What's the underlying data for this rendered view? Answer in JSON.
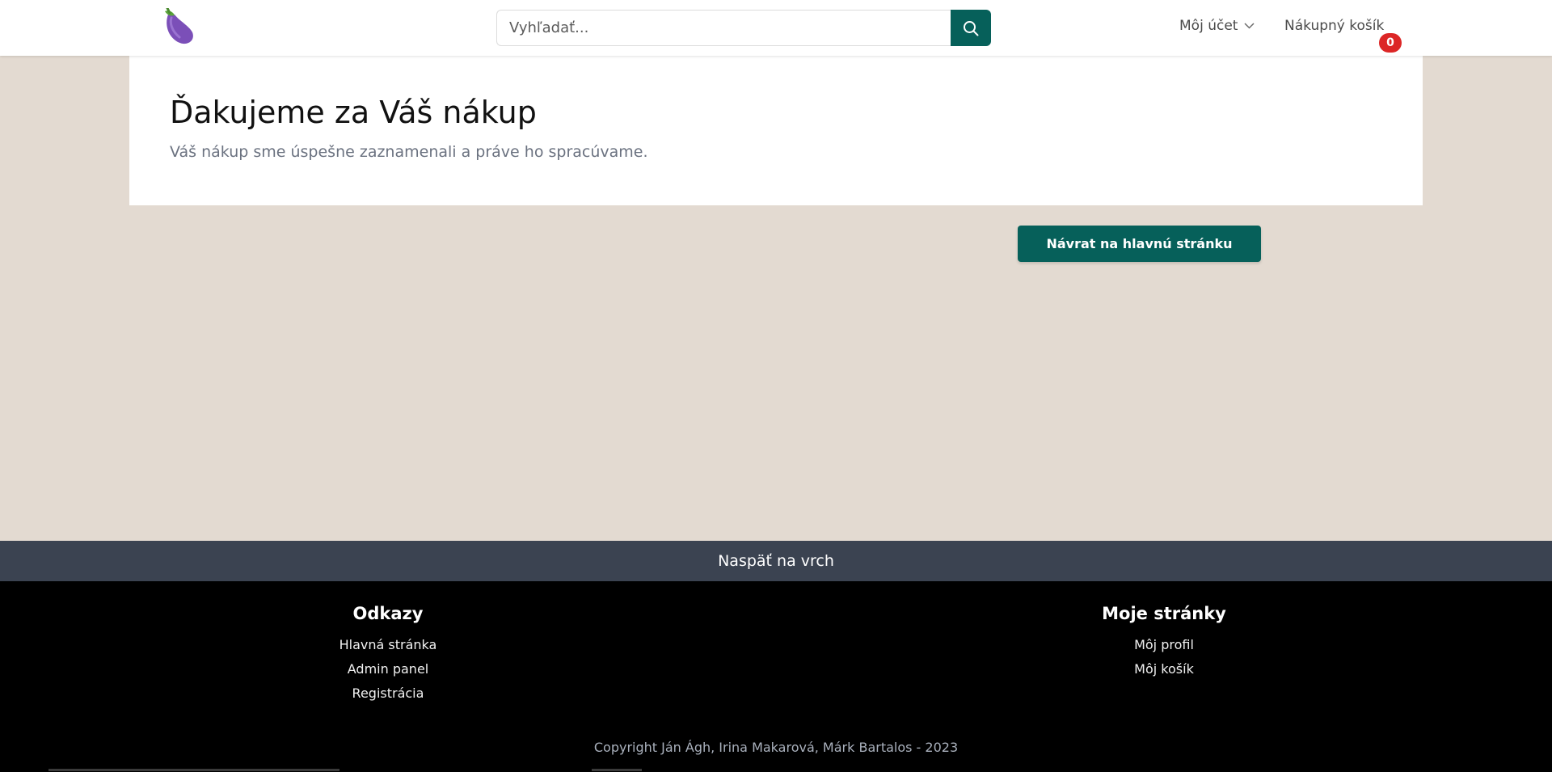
{
  "header": {
    "logo_icon": "eggplant-icon",
    "search": {
      "placeholder": "Vyhľadať...",
      "value": "",
      "button_icon": "search-icon"
    },
    "account": {
      "label": "Môj účet",
      "icon": "chevron-down-icon"
    },
    "cart": {
      "label": "Nákupný košík",
      "count": "0"
    }
  },
  "main": {
    "title": "Ďakujeme za Váš nákup",
    "subtitle": "Váš nákup sme úspešne zaznamenali a práve ho spracúvame.",
    "home_button": "Návrat na hlavnú stránku"
  },
  "back_to_top": "Naspäť na vrch",
  "footer": {
    "links": {
      "heading": "Odkazy",
      "items": [
        "Hlavná stránka",
        "Admin panel",
        "Registrácia"
      ]
    },
    "my_pages": {
      "heading": "Moje stránky",
      "items": [
        "Môj profil",
        "Môj košík"
      ]
    },
    "copyright": "Copyright Ján Ágh, Irina Makarová, Márk Bartalos - 2023"
  },
  "colors": {
    "accent": "#06605a",
    "page_background": "#e3dad1",
    "badge": "#dc2626",
    "back_to_top_bar": "#3b4351",
    "footer": "#000000"
  }
}
